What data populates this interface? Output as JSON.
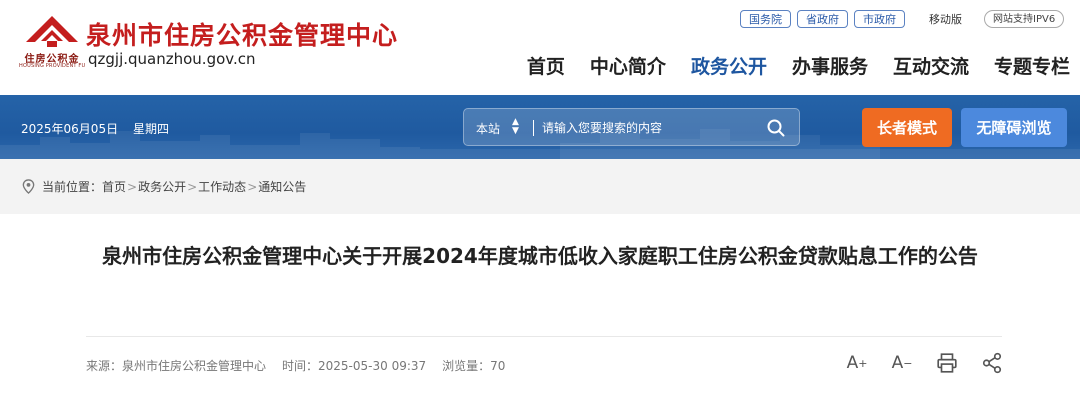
{
  "header": {
    "title": "泉州市住房公积金管理中心",
    "domain": "qzgjj.quanzhou.gov.cn",
    "logo_caption": "住房公积金",
    "logo_caption_en": "HOUSING PROVIDENT FUND",
    "top_links": [
      "国务院",
      "省政府",
      "市政府"
    ],
    "mobile_label": "移动版",
    "ipv6_label": "网站支持IPV6",
    "nav": [
      "首页",
      "中心简介",
      "政务公开",
      "办事服务",
      "互动交流",
      "专题专栏"
    ],
    "active_nav": "政务公开",
    "brand_color": "#c41e1e",
    "accent_color": "#1e56a0"
  },
  "banner": {
    "date": "2025年06月05日",
    "weekday": "星期四",
    "search_scope": "本站",
    "search_placeholder": "请输入您要搜索的内容",
    "elder_mode_label": "长者模式",
    "accessibility_label": "无障碍浏览",
    "icons": [
      "search-icon"
    ]
  },
  "breadcrumb": {
    "prefix": "当前位置：",
    "items": [
      "首页",
      "政务公开",
      "工作动态",
      "通知公告"
    ],
    "separator": ">"
  },
  "article": {
    "title": "泉州市住房公积金管理中心关于开展2024年度城市低收入家庭职工住房公积金贷款贴息工作的公告",
    "source": "来源：泉州市住房公积金管理中心",
    "time": "时间：2025-05-30 09:37",
    "views": "浏览量：70",
    "tools": {
      "font_increase": "A",
      "font_increase_sup": "+",
      "font_decrease": "A",
      "font_decrease_sup": "−"
    }
  }
}
